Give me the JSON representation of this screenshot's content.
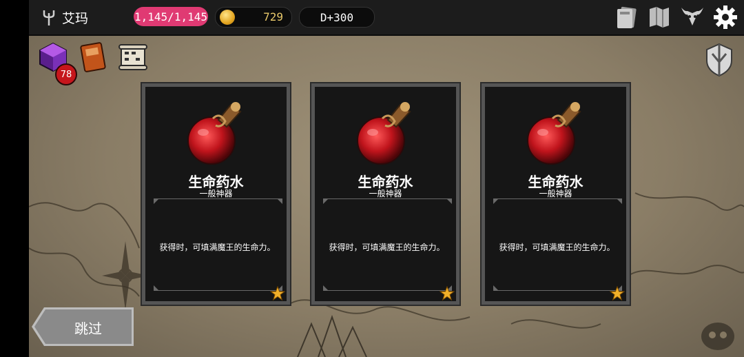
{
  "header": {
    "player_name": "艾玛",
    "hp": "1,145/1,145",
    "gold": "729",
    "day": "D+300",
    "icons": [
      "card-icon",
      "map-icon",
      "demon-head-icon",
      "gear-icon"
    ]
  },
  "toolbar": {
    "icons": [
      "cube-icon",
      "book-icon",
      "scroll-icon"
    ],
    "badge_count": "78"
  },
  "cards": [
    {
      "name": "生命药水",
      "rarity": "一般神器",
      "description": "获得时，可填满魔王的生命力。",
      "stars": 1
    },
    {
      "name": "生命药水",
      "rarity": "一般神器",
      "description": "获得时，可填满魔王的生命力。",
      "stars": 1
    },
    {
      "name": "生命药水",
      "rarity": "一般神器",
      "description": "获得时，可填满魔王的生命力。",
      "stars": 1
    }
  ],
  "skip_label": "跳过",
  "colors": {
    "hp_pill": "#e03a73",
    "gold": "#e9c96b",
    "potion_red": "#c0141c"
  }
}
